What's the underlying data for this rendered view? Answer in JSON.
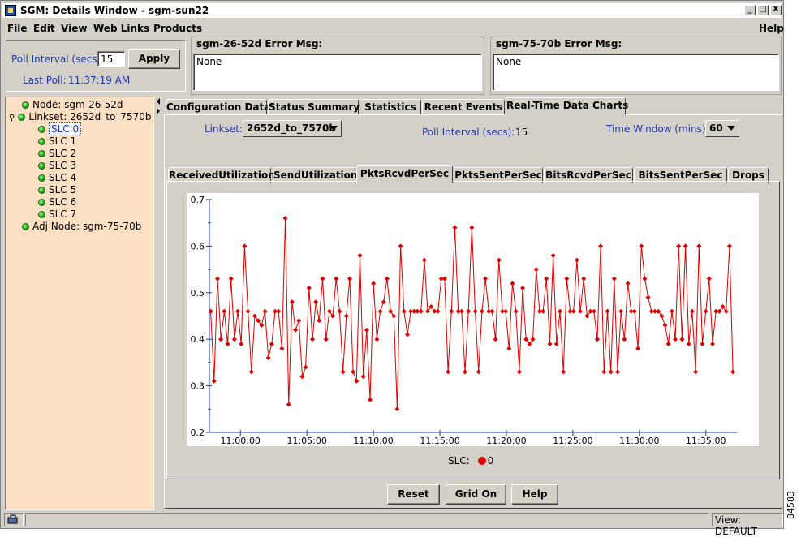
{
  "window": {
    "title": "SGM: Details Window - sgm-sun22",
    "minimize": "_",
    "maximize": "□",
    "close": "X"
  },
  "menu": {
    "file": "File",
    "edit": "Edit",
    "view": "View",
    "web_links": "Web Links",
    "products": "Products",
    "help": "Help"
  },
  "poll": {
    "label": "Poll Interval (secs)",
    "value": "15",
    "apply": "Apply",
    "last_poll_label": "Last Poll:",
    "last_poll_time": "11:37:19 AM"
  },
  "errors": [
    {
      "title": "sgm-26-52d  Error Msg:",
      "message": "None"
    },
    {
      "title": "sgm-75-70b  Error Msg:",
      "message": "None"
    }
  ],
  "tree": [
    {
      "label": "Node: sgm-26-52d"
    },
    {
      "label": "Linkset: 2652d_to_7570b"
    },
    {
      "label": "SLC 0"
    },
    {
      "label": "SLC 1"
    },
    {
      "label": "SLC 2"
    },
    {
      "label": "SLC 3"
    },
    {
      "label": "SLC 4"
    },
    {
      "label": "SLC 5"
    },
    {
      "label": "SLC 6"
    },
    {
      "label": "SLC 7"
    },
    {
      "label": "Adj Node: sgm-75-70b"
    }
  ],
  "main_tabs": [
    "Configuration Data",
    "Status Summary",
    "Statistics",
    "Recent Events",
    "Real-Time Data Charts"
  ],
  "controls": {
    "linkset_label": "Linkset:",
    "linkset_value": "2652d_to_7570b",
    "poll_label": "Poll Interval (secs):",
    "poll_value": "15",
    "time_window_label": "Time Window (mins):",
    "time_window_value": "60"
  },
  "sub_tabs": [
    "ReceivedUtilization",
    "SendUtilization",
    "PktsRcvdPerSec",
    "PktsSentPerSec",
    "BitsRcvdPerSec",
    "BitsSentPerSec",
    "Drops"
  ],
  "buttons": {
    "reset": "Reset",
    "grid": "Grid On",
    "help": "Help"
  },
  "status": {
    "view": "View: DEFAULT"
  },
  "side_id": "84583",
  "colors": {
    "series": "#dd0000",
    "tree_bg": "#fbe0c4",
    "axis": "#1e3aa8"
  },
  "chart_data": {
    "type": "line",
    "legend_label": "SLC:",
    "series": [
      {
        "name": "0",
        "values": [
          0.46,
          0.31,
          0.53,
          0.4,
          0.46,
          0.39,
          0.53,
          0.4,
          0.46,
          0.39,
          0.6,
          0.46,
          0.33,
          0.45,
          0.44,
          0.43,
          0.46,
          0.36,
          0.39,
          0.46,
          0.46,
          0.38,
          0.66,
          0.26,
          0.48,
          0.42,
          0.44,
          0.32,
          0.34,
          0.51,
          0.4,
          0.48,
          0.44,
          0.53,
          0.4,
          0.46,
          0.45,
          0.53,
          0.46,
          0.33,
          0.45,
          0.53,
          0.33,
          0.31,
          0.58,
          0.32,
          0.42,
          0.27,
          0.52,
          0.4,
          0.46,
          0.48,
          0.53,
          0.46,
          0.45,
          0.25,
          0.6,
          0.46,
          0.41,
          0.46,
          0.46,
          0.46,
          0.46,
          0.57,
          0.46,
          0.47,
          0.46,
          0.46,
          0.53,
          0.53,
          0.33,
          0.46,
          0.64,
          0.46,
          0.46,
          0.33,
          0.46,
          0.64,
          0.46,
          0.33,
          0.46,
          0.53,
          0.46,
          0.46,
          0.4,
          0.57,
          0.46,
          0.46,
          0.38,
          0.52,
          0.46,
          0.33,
          0.51,
          0.4,
          0.39,
          0.4,
          0.55,
          0.46,
          0.46,
          0.53,
          0.39,
          0.58,
          0.39,
          0.46,
          0.33,
          0.53,
          0.46,
          0.46,
          0.57,
          0.46,
          0.53,
          0.45,
          0.46,
          0.46,
          0.4,
          0.6,
          0.33,
          0.46,
          0.33,
          0.53,
          0.33,
          0.46,
          0.4,
          0.52,
          0.46,
          0.46,
          0.38,
          0.6,
          0.53,
          0.49,
          0.46,
          0.46,
          0.46,
          0.45,
          0.43,
          0.39,
          0.46,
          0.4,
          0.6,
          0.4,
          0.6,
          0.39,
          0.46,
          0.33,
          0.6,
          0.39,
          0.46,
          0.53,
          0.39,
          0.46,
          0.46,
          0.47,
          0.46,
          0.6,
          0.33
        ]
      }
    ],
    "x_tick_labels": [
      "11:00:00",
      "11:05:00",
      "11:10:00",
      "11:15:00",
      "11:20:00",
      "11:25:00",
      "11:30:00",
      "11:35:00"
    ],
    "x_range": [
      "10:57:40",
      "11:37:20"
    ],
    "y_ticks": [
      0.2,
      0.3,
      0.4,
      0.5,
      0.6,
      0.7
    ],
    "y_tick_labels": [
      "0.2",
      "0.3",
      "0.4",
      "0.5",
      "0.6",
      "0.7"
    ],
    "ylim": [
      0.2,
      0.7
    ],
    "grid": false,
    "legend_position": "bottom-center"
  }
}
